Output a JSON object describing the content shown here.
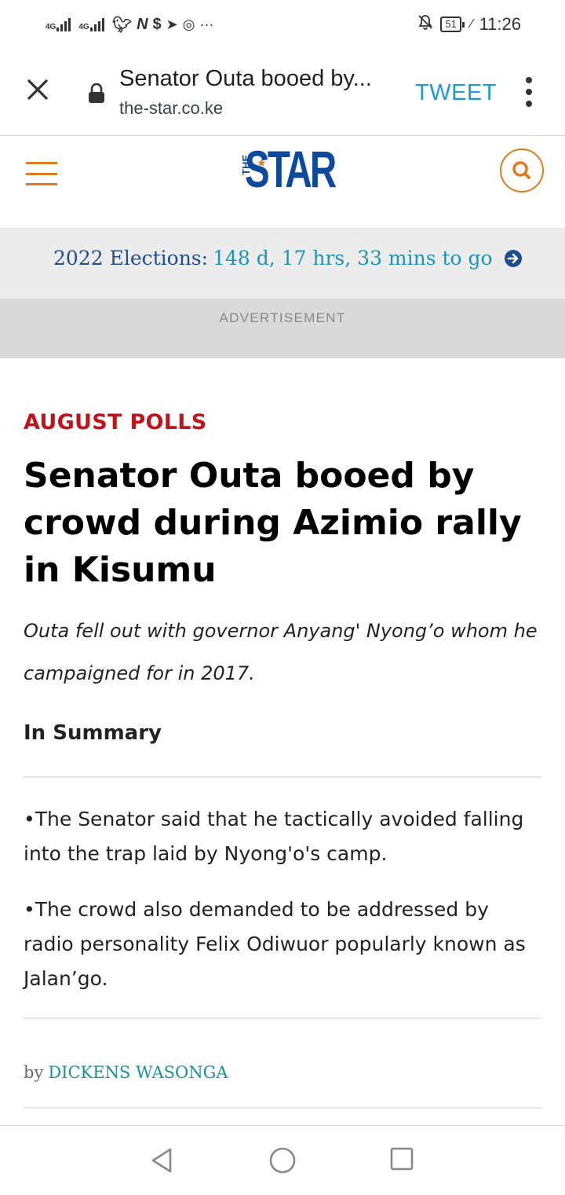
{
  "status_bar": {
    "signal_1_label": "4G",
    "signal_2_label": "4G",
    "app_icons": [
      "twitter-icon",
      "nation-icon",
      "s-app-icon",
      "telegram-icon",
      "vpn-icon"
    ],
    "more": "···",
    "battery": "51",
    "time": "11:26"
  },
  "browser": {
    "page_title": "Senator Outa booed by...",
    "url": "the-star.co.ke",
    "tweet_label": "TWEET"
  },
  "site": {
    "logo_the": "THE",
    "logo_text": "STAR",
    "accent_color": "#e07b1f",
    "brand_color": "#0c4a9e"
  },
  "elections": {
    "label": "2022 Elections:",
    "countdown": "148 d, 17 hrs, 33 mins to go"
  },
  "ad": {
    "label": "ADVERTISEMENT"
  },
  "article": {
    "kicker": "AUGUST POLLS",
    "headline": "Senator Outa booed by crowd during Azimio rally in Kisumu",
    "standfirst": "Outa fell out with governor Anyang' Nyong’o whom he campaigned for in 2017.",
    "summary_heading": "In Summary",
    "summary_items": [
      "•The Senator said that he tactically avoided falling into the trap laid by Nyong'o's camp.",
      "•The crowd also demanded to be addressed by radio personality Felix Odiwuor popularly known as Jalan’go."
    ],
    "byline_prefix": "by",
    "author": "DICKENS WASONGA"
  }
}
